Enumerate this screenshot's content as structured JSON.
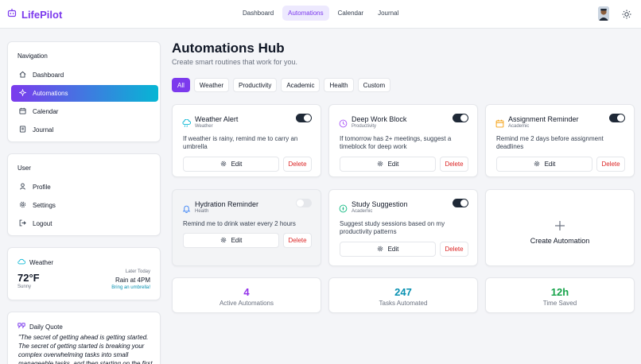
{
  "app": {
    "name": "LifePilot"
  },
  "nav": {
    "tabs": [
      "Dashboard",
      "Automations",
      "Calendar",
      "Journal"
    ],
    "active": "Automations"
  },
  "sidebar": {
    "navigation_title": "Navigation",
    "nav_items": [
      {
        "label": "Dashboard",
        "icon": "home-icon"
      },
      {
        "label": "Automations",
        "icon": "sparkle-icon",
        "active": true
      },
      {
        "label": "Calendar",
        "icon": "calendar-icon"
      },
      {
        "label": "Journal",
        "icon": "journal-icon"
      }
    ],
    "user_title": "User",
    "user_items": [
      {
        "label": "Profile",
        "icon": "person-icon"
      },
      {
        "label": "Settings",
        "icon": "gear-icon"
      },
      {
        "label": "Logout",
        "icon": "logout-icon"
      }
    ]
  },
  "weather": {
    "title": "Weather",
    "temp": "72°F",
    "condition": "Sunny",
    "later_label": "Later Today",
    "later_value": "Rain at 4PM",
    "advice": "Bring an umbrella!"
  },
  "quote": {
    "title": "Daily Quote",
    "text": "\"The secret of getting ahead is getting started. The secret of getting started is breaking your complex overwhelming tasks into small manageable tasks, and then starting on the first one.\""
  },
  "main": {
    "title": "Automations Hub",
    "subtitle": "Create smart routines that work for you.",
    "filters": [
      "All",
      "Weather",
      "Productivity",
      "Academic",
      "Health",
      "Custom"
    ],
    "active_filter": "All",
    "edit_label": "Edit",
    "delete_label": "Delete",
    "automations": [
      {
        "title": "Weather Alert",
        "category": "Weather",
        "description": "If weather is rainy, remind me to carry an umbrella",
        "enabled": true,
        "icon": "cloud-rain-icon",
        "color": "#06b6d4"
      },
      {
        "title": "Deep Work Block",
        "category": "Productivity",
        "description": "If tomorrow has 2+ meetings, suggest a timeblock for deep work",
        "enabled": true,
        "icon": "clock-icon",
        "color": "#a855f7"
      },
      {
        "title": "Assignment Reminder",
        "category": "Academic",
        "description": "Remind me 2 days before assignment deadlines",
        "enabled": true,
        "icon": "calendar-icon",
        "color": "#f59e0b"
      },
      {
        "title": "Hydration Reminder",
        "category": "Health",
        "description": "Remind me to drink water every 2 hours",
        "enabled": false,
        "icon": "bell-icon",
        "color": "#3b82f6"
      },
      {
        "title": "Study Suggestion",
        "category": "Academic",
        "description": "Suggest study sessions based on my productivity patterns",
        "enabled": true,
        "icon": "compass-icon",
        "color": "#10b981"
      }
    ],
    "create_label": "Create Automation",
    "stats": [
      {
        "value": "4",
        "label": "Active Automations",
        "color": "#9333ea"
      },
      {
        "value": "247",
        "label": "Tasks Automated",
        "color": "#0891b2"
      },
      {
        "value": "12h",
        "label": "Time Saved",
        "color": "#16a34a"
      }
    ]
  }
}
